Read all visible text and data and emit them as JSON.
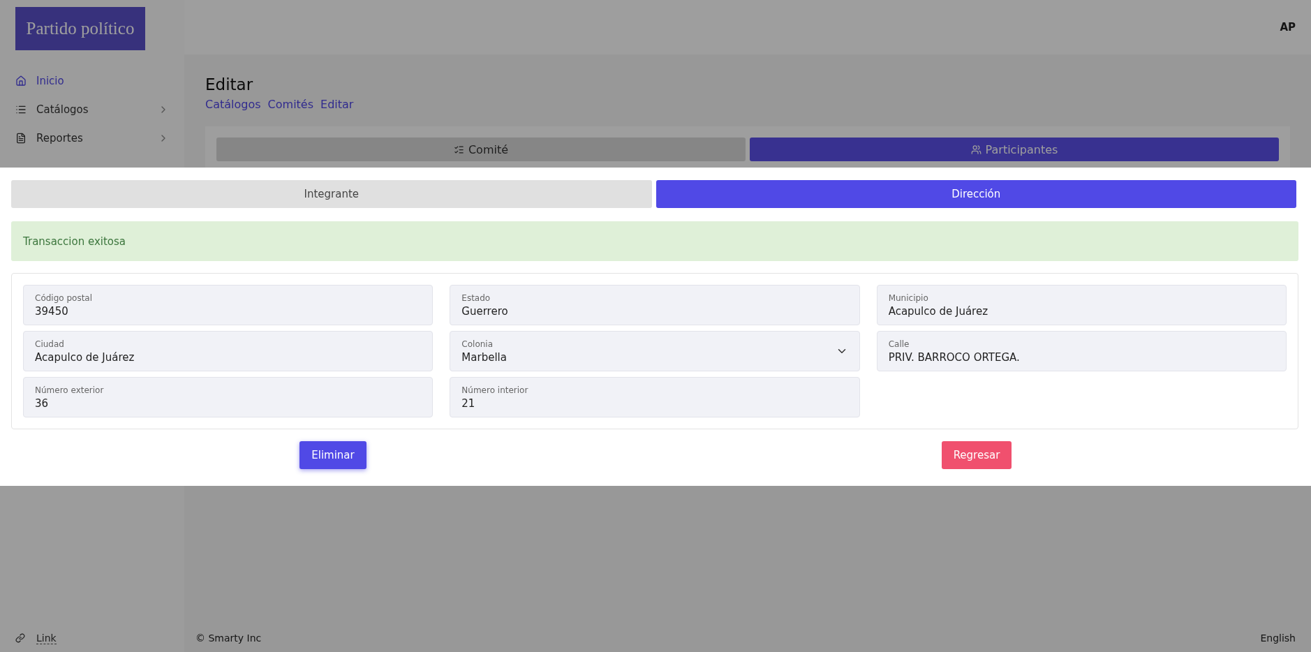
{
  "logo": {
    "text": "Partido político"
  },
  "user": {
    "initials": "AP"
  },
  "sidebar": {
    "items": [
      {
        "label": "Inicio",
        "selected": true,
        "has_children": false
      },
      {
        "label": "Catálogos",
        "selected": false,
        "has_children": true
      },
      {
        "label": "Reportes",
        "selected": false,
        "has_children": true
      }
    ],
    "footer_link": "Link"
  },
  "page": {
    "title": "Editar",
    "breadcrumb": [
      "Catálogos",
      "Comités",
      "Editar"
    ],
    "tabs": [
      {
        "label": "Comité",
        "selected": false
      },
      {
        "label": "Participantes",
        "selected": true
      }
    ]
  },
  "modal": {
    "tabs": [
      {
        "label": "Integrante",
        "selected": false
      },
      {
        "label": "Dirección",
        "selected": true
      }
    ],
    "alert": "Transaccion exitosa",
    "fields": [
      {
        "kind": "text",
        "label": "Código postal",
        "value": "39450"
      },
      {
        "kind": "text",
        "label": "Estado",
        "value": "Guerrero"
      },
      {
        "kind": "text",
        "label": "Municipio",
        "value": "Acapulco de Juárez"
      },
      {
        "kind": "text",
        "label": "Ciudad",
        "value": "Acapulco de Juárez"
      },
      {
        "kind": "select",
        "label": "Colonia",
        "value": "Marbella"
      },
      {
        "kind": "text",
        "label": "Calle",
        "value": "PRIV. BARROCO ORTEGA."
      },
      {
        "kind": "text",
        "label": "Número exterior",
        "value": "36"
      },
      {
        "kind": "text",
        "label": "Número interior",
        "value": "21"
      }
    ],
    "buttons": [
      {
        "label": "Eliminar",
        "kind": "primary"
      },
      {
        "label": "Regresar",
        "kind": "danger"
      }
    ]
  },
  "footer": {
    "copyright": "© Smarty Inc",
    "language": "English"
  }
}
